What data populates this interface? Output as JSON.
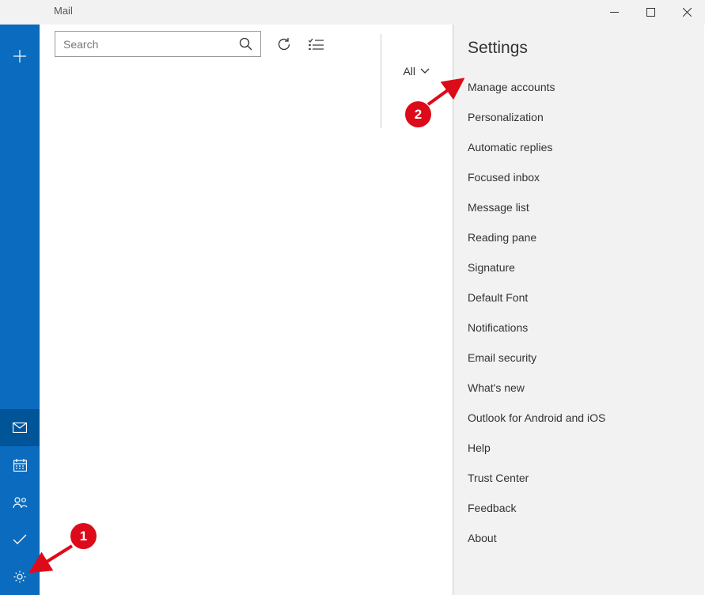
{
  "window": {
    "title": "Mail"
  },
  "search": {
    "placeholder": "Search"
  },
  "filter": {
    "label": "All"
  },
  "settings": {
    "title": "Settings",
    "items": [
      "Manage accounts",
      "Personalization",
      "Automatic replies",
      "Focused inbox",
      "Message list",
      "Reading pane",
      "Signature",
      "Default Font",
      "Notifications",
      "Email security",
      "What's new",
      "Outlook for Android and iOS",
      "Help",
      "Trust Center",
      "Feedback",
      "About"
    ]
  },
  "annotations": {
    "badge1": "1",
    "badge2": "2"
  }
}
